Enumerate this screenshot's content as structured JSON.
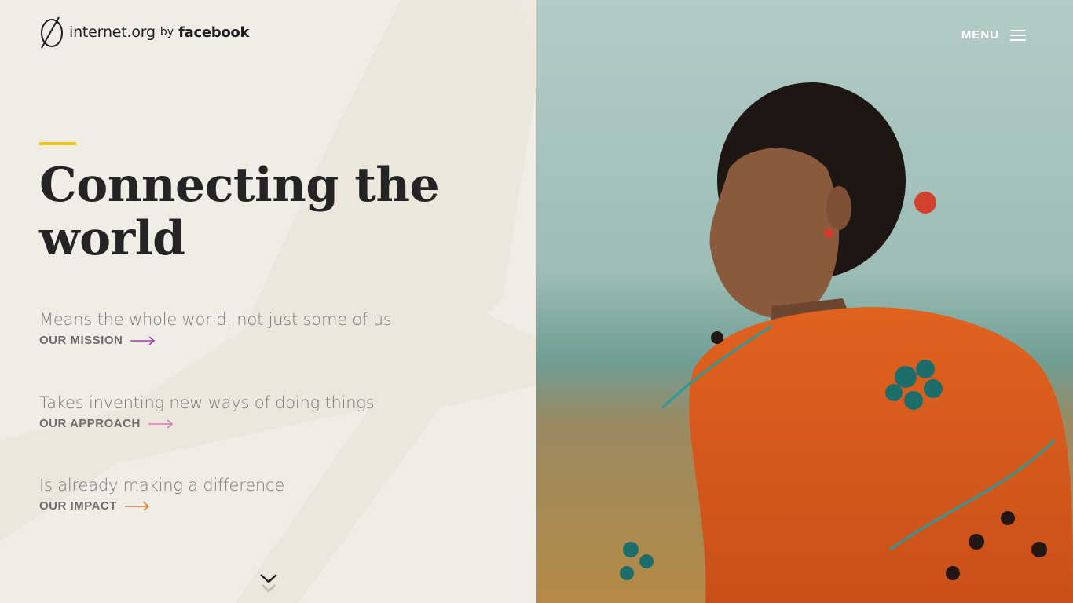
{
  "header": {
    "logo_text": "internet.org",
    "logo_by": "by",
    "logo_brand": "facebook",
    "menu_label": "MENU"
  },
  "hero": {
    "headline": "Connecting the world",
    "accent_color": "#f5c518"
  },
  "items": [
    {
      "description": "Means the whole world, not just some of us",
      "link_label": "OUR MISSION",
      "arrow_color": "#9b3fa8"
    },
    {
      "description": "Takes inventing new ways of doing things",
      "link_label": "OUR APPROACH",
      "arrow_color": "#d77bb8"
    },
    {
      "description": "Is already making a difference",
      "link_label": "OUR IMPACT",
      "arrow_color": "#ea7a2c"
    }
  ],
  "icons": {
    "logo": "internet-org-logo-icon",
    "menu": "hamburger-menu-icon",
    "scroll": "chevron-down-icon",
    "arrow": "arrow-right-icon"
  },
  "colors": {
    "left_background": "#f0ede6",
    "text_dark": "#242424",
    "text_muted": "#7a7a7a"
  }
}
